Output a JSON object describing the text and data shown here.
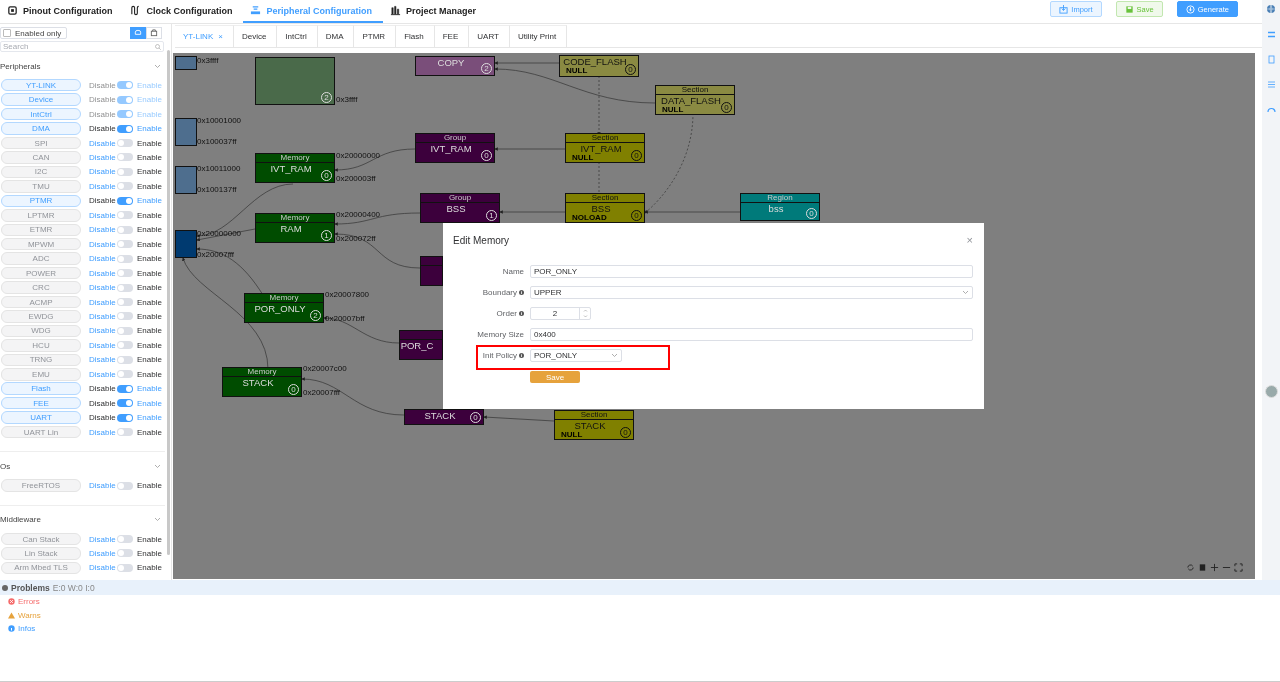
{
  "nav_tabs": [
    {
      "label": "Pinout Configuration",
      "kind": "chip",
      "selected": false
    },
    {
      "label": "Clock Configuration",
      "kind": "clock",
      "selected": false
    },
    {
      "label": "Peripheral Configuration",
      "kind": "peripheral",
      "selected": true
    },
    {
      "label": "Project Manager",
      "kind": "project",
      "selected": false
    }
  ],
  "toolbar_buttons": [
    {
      "label": "Import",
      "kind": "import"
    },
    {
      "label": "Save",
      "kind": "save"
    },
    {
      "label": "Generate",
      "kind": "generate"
    }
  ],
  "sidebar": {
    "enabled_only": {
      "label": "Enabled only",
      "checked": false
    },
    "view_buttons": [
      {
        "kind": "grid",
        "selected": true
      },
      {
        "kind": "package",
        "selected": false
      }
    ],
    "search": {
      "placeholder": "Search"
    },
    "sections": [
      {
        "title": "Peripherals",
        "expanded": true,
        "items": [
          {
            "name": "YT-LINK",
            "on": true,
            "disabled": true,
            "off_label": "Disable",
            "on_label": "Enable"
          },
          {
            "name": "Device",
            "on": true,
            "disabled": true,
            "off_label": "Disable",
            "on_label": "Enable"
          },
          {
            "name": "IntCtrl",
            "on": true,
            "disabled": true,
            "off_label": "Disable",
            "on_label": "Enable"
          },
          {
            "name": "DMA",
            "on": true,
            "disabled": false,
            "off_label": "Disable",
            "on_label": "Enable"
          },
          {
            "name": "SPI",
            "on": false,
            "disabled": false,
            "off_label": "Disable",
            "on_label": "Enable"
          },
          {
            "name": "CAN",
            "on": false,
            "disabled": false,
            "off_label": "Disable",
            "on_label": "Enable"
          },
          {
            "name": "I2C",
            "on": false,
            "disabled": false,
            "off_label": "Disable",
            "on_label": "Enable"
          },
          {
            "name": "TMU",
            "on": false,
            "disabled": false,
            "off_label": "Disable",
            "on_label": "Enable"
          },
          {
            "name": "PTMR",
            "on": true,
            "disabled": false,
            "off_label": "Disable",
            "on_label": "Enable"
          },
          {
            "name": "LPTMR",
            "on": false,
            "disabled": false,
            "off_label": "Disable",
            "on_label": "Enable"
          },
          {
            "name": "ETMR",
            "on": false,
            "disabled": false,
            "off_label": "Disable",
            "on_label": "Enable"
          },
          {
            "name": "MPWM",
            "on": false,
            "disabled": false,
            "off_label": "Disable",
            "on_label": "Enable"
          },
          {
            "name": "ADC",
            "on": false,
            "disabled": false,
            "off_label": "Disable",
            "on_label": "Enable"
          },
          {
            "name": "POWER",
            "on": false,
            "disabled": false,
            "off_label": "Disable",
            "on_label": "Enable"
          },
          {
            "name": "CRC",
            "on": false,
            "disabled": false,
            "off_label": "Disable",
            "on_label": "Enable"
          },
          {
            "name": "ACMP",
            "on": false,
            "disabled": false,
            "off_label": "Disable",
            "on_label": "Enable"
          },
          {
            "name": "EWDG",
            "on": false,
            "disabled": false,
            "off_label": "Disable",
            "on_label": "Enable"
          },
          {
            "name": "WDG",
            "on": false,
            "disabled": false,
            "off_label": "Disable",
            "on_label": "Enable"
          },
          {
            "name": "HCU",
            "on": false,
            "disabled": false,
            "off_label": "Disable",
            "on_label": "Enable"
          },
          {
            "name": "TRNG",
            "on": false,
            "disabled": false,
            "off_label": "Disable",
            "on_label": "Enable"
          },
          {
            "name": "EMU",
            "on": false,
            "disabled": false,
            "off_label": "Disable",
            "on_label": "Enable"
          },
          {
            "name": "Flash",
            "on": true,
            "disabled": false,
            "off_label": "Disable",
            "on_label": "Enable"
          },
          {
            "name": "FEE",
            "on": true,
            "disabled": false,
            "off_label": "Disable",
            "on_label": "Enable"
          },
          {
            "name": "UART",
            "on": true,
            "disabled": false,
            "off_label": "Disable",
            "on_label": "Enable"
          },
          {
            "name": "UART Lin",
            "on": false,
            "disabled": false,
            "off_label": "Disable",
            "on_label": "Enable"
          }
        ]
      },
      {
        "title": "Os",
        "expanded": true,
        "items": [
          {
            "name": "FreeRTOS",
            "on": false,
            "disabled": false,
            "off_label": "Disable",
            "on_label": "Enable"
          }
        ]
      },
      {
        "title": "Middleware",
        "expanded": true,
        "items": [
          {
            "name": "Can Stack",
            "on": false,
            "disabled": false,
            "off_label": "Disable",
            "on_label": "Enable"
          },
          {
            "name": "Lin Stack",
            "on": false,
            "disabled": false,
            "off_label": "Disable",
            "on_label": "Enable"
          },
          {
            "name": "Arm Mbed TLS",
            "on": false,
            "disabled": false,
            "off_label": "Disable",
            "on_label": "Enable"
          }
        ]
      }
    ]
  },
  "editor_tabs": [
    {
      "label": "YT-LINK",
      "selected": true,
      "close": "×"
    },
    {
      "label": "Device",
      "selected": false
    },
    {
      "label": "IntCtrl",
      "selected": false
    },
    {
      "label": "DMA",
      "selected": false
    },
    {
      "label": "PTMR",
      "selected": false
    },
    {
      "label": "Flash",
      "selected": false
    },
    {
      "label": "FEE",
      "selected": false
    },
    {
      "label": "UART",
      "selected": false
    },
    {
      "label": "Utility Print",
      "selected": false
    }
  ],
  "canvas": {
    "nodes": [
      {
        "kind": "block",
        "dimmed": true,
        "addresses": [
          "0x3ffff"
        ]
      },
      {
        "kind": "memory",
        "dimmed": true,
        "badge": "2",
        "addresses": [
          "0x3ffff"
        ]
      },
      {
        "kind": "block",
        "dimmed": true,
        "addresses": [
          "0x10001000",
          "0x100037ff"
        ]
      },
      {
        "kind": "block",
        "dimmed": true,
        "addresses": [
          "0x10011000",
          "0x100137ff"
        ]
      },
      {
        "kind": "block",
        "dimmed": false,
        "addresses": [
          "0x20000000",
          "0x20007fff"
        ]
      },
      {
        "kind": "memory",
        "dimmed": false,
        "header": "Memory",
        "label": "IVT_RAM",
        "badge": "0",
        "addresses": [
          "0x20000000",
          "0x200003ff"
        ]
      },
      {
        "kind": "memory",
        "dimmed": false,
        "header": "Memory",
        "label": "RAM",
        "badge": "1",
        "addresses": [
          "0x20000400",
          "0x200072ff"
        ]
      },
      {
        "kind": "memory",
        "dimmed": false,
        "header": "Memory",
        "label": "POR_ONLY",
        "badge": "2",
        "addresses": [
          "0x20007800",
          "0x20007bff"
        ]
      },
      {
        "kind": "memory",
        "dimmed": false,
        "header": "Memory",
        "label": "STACK",
        "badge": "0",
        "addresses": [
          "0x20007c00",
          "0x20007fff"
        ]
      },
      {
        "kind": "group",
        "dimmed": true,
        "label": "COPY",
        "badge": "2"
      },
      {
        "kind": "group",
        "dimmed": false,
        "header": "Group",
        "label": "IVT_RAM",
        "badge": "0"
      },
      {
        "kind": "group",
        "dimmed": false,
        "header": "Group",
        "label": "BSS",
        "badge": "1"
      },
      {
        "kind": "group",
        "dimmed": false
      },
      {
        "kind": "group",
        "dimmed": false,
        "label": "POR_C"
      },
      {
        "kind": "group",
        "dimmed": false,
        "label": "STACK",
        "badge": "0"
      },
      {
        "kind": "section",
        "dimmed": true,
        "label": "CODE_FLASH",
        "policy": "NULL",
        "badge": "0"
      },
      {
        "kind": "section",
        "dimmed": true,
        "header": "Section",
        "label": "DATA_FLASH",
        "policy": "NULL",
        "badge": "0"
      },
      {
        "kind": "section",
        "dimmed": false,
        "header": "Section",
        "label": "IVT_RAM",
        "policy": "NULL",
        "badge": "0"
      },
      {
        "kind": "section",
        "dimmed": false,
        "header": "Section",
        "label": "BSS",
        "policy": "NOLOAD",
        "badge": "0"
      },
      {
        "kind": "region",
        "dimmed": false,
        "header": "Region",
        "label": "bss",
        "badge": "0"
      },
      {
        "kind": "section",
        "dimmed": false,
        "header": "Section",
        "label": "STACK",
        "policy": "NULL",
        "badge": "0"
      }
    ]
  },
  "dialog": {
    "title": "Edit Memory",
    "close": "×",
    "fields": [
      {
        "label": "Name",
        "kind": "text",
        "value": "POR_ONLY",
        "info": false,
        "highlighted": false
      },
      {
        "label": "Boundary",
        "kind": "select",
        "value": "UPPER",
        "info": true,
        "highlighted": false
      },
      {
        "label": "Order",
        "kind": "number",
        "value": "2",
        "info": true,
        "highlighted": false
      },
      {
        "label": "Memory Size",
        "kind": "text",
        "value": "0x400",
        "info": false,
        "highlighted": false
      },
      {
        "label": "Init Policy",
        "kind": "select-short",
        "value": "POR_ONLY",
        "info": true,
        "highlighted": true
      }
    ],
    "save_label": "Save"
  },
  "problems": {
    "title": "Problems",
    "counts": "E:0 W:0 I:0",
    "items": [
      {
        "label": "Errors",
        "kind": "error"
      },
      {
        "label": "Warns",
        "kind": "warn"
      },
      {
        "label": "Infos",
        "kind": "info"
      }
    ]
  }
}
